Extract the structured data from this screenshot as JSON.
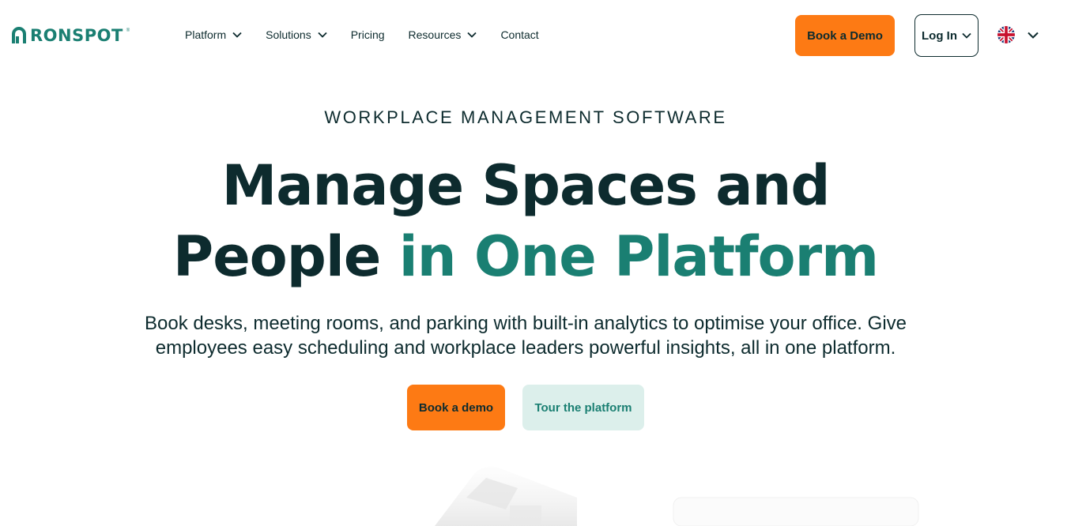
{
  "brand": {
    "name": "RONSPOT",
    "reg": "®",
    "color": "#1a7f72"
  },
  "nav": [
    {
      "label": "Platform",
      "dropdown": true
    },
    {
      "label": "Solutions",
      "dropdown": true
    },
    {
      "label": "Pricing",
      "dropdown": false
    },
    {
      "label": "Resources",
      "dropdown": true
    },
    {
      "label": "Contact",
      "dropdown": false
    }
  ],
  "header": {
    "book_demo_label": "Book a Demo",
    "login_label": "Log In",
    "language_icon": "uk-flag-icon"
  },
  "hero": {
    "eyebrow": "WORKPLACE MANAGEMENT SOFTWARE",
    "headline_part1": "Manage Spaces and",
    "headline_part2": "People ",
    "headline_accent": "in One Platform",
    "subtitle_line1": "Book desks, meeting rooms, and parking with built-in analytics to optimise your office. Give",
    "subtitle_line2": "employees easy scheduling and workplace leaders powerful insights, all in one platform.",
    "cta_primary": "Book a demo",
    "cta_secondary": "Tour the platform"
  },
  "colors": {
    "accent": "#1a7f72",
    "cta": "#fd7a14",
    "text": "#0d2b2e",
    "secondary_bg": "#dcefeb"
  }
}
